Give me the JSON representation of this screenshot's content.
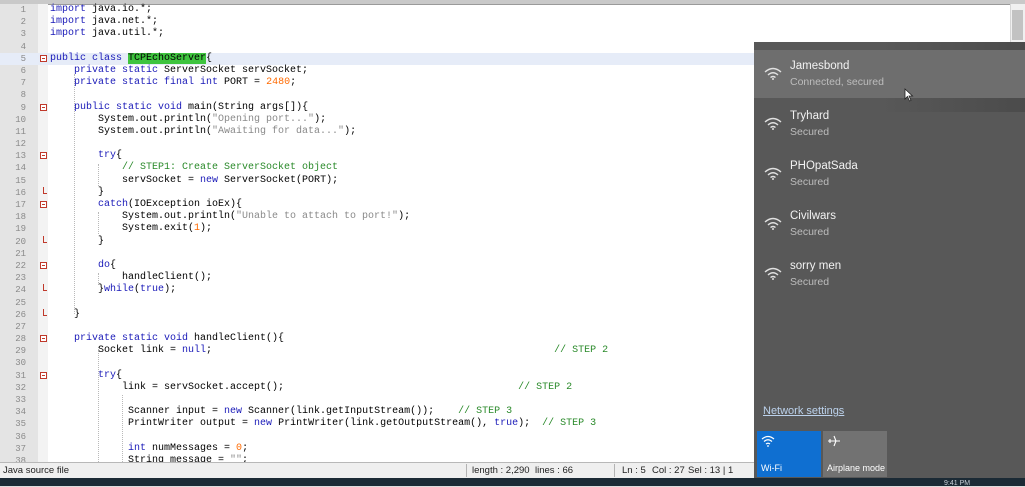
{
  "editor": {
    "lines": [
      {
        "n": "1",
        "fold": "",
        "parts": [
          [
            "kw",
            "import "
          ],
          [
            "",
            "java.io.*;"
          ]
        ]
      },
      {
        "n": "2",
        "fold": "",
        "parts": [
          [
            "kw",
            "import "
          ],
          [
            "",
            "java.net.*;"
          ]
        ]
      },
      {
        "n": "3",
        "fold": "",
        "parts": [
          [
            "kw",
            "import "
          ],
          [
            "",
            "java.util.*;"
          ]
        ]
      },
      {
        "n": "4",
        "fold": "",
        "parts": []
      },
      {
        "n": "5",
        "fold": "open",
        "current": true,
        "parts": [
          [
            "kw",
            "public class "
          ],
          [
            "hl",
            "TCPEchoServer"
          ],
          [
            "",
            "{"
          ]
        ]
      },
      {
        "n": "6",
        "fold": "",
        "parts": [
          [
            "",
            "    "
          ],
          [
            "kw",
            "private static "
          ],
          [
            "",
            "ServerSocket servSocket;"
          ]
        ]
      },
      {
        "n": "7",
        "fold": "",
        "parts": [
          [
            "",
            "    "
          ],
          [
            "kw",
            "private static final int "
          ],
          [
            "",
            "PORT = "
          ],
          [
            "num",
            "2480"
          ],
          [
            "",
            ";"
          ]
        ]
      },
      {
        "n": "8",
        "fold": "",
        "parts": []
      },
      {
        "n": "9",
        "fold": "open",
        "parts": [
          [
            "",
            "    "
          ],
          [
            "kw",
            "public static void "
          ],
          [
            "",
            "main(String args[]){"
          ]
        ]
      },
      {
        "n": "10",
        "fold": "",
        "parts": [
          [
            "",
            "        System.out.println("
          ],
          [
            "str",
            "\"Opening port...\""
          ],
          [
            "",
            ");"
          ]
        ]
      },
      {
        "n": "11",
        "fold": "",
        "parts": [
          [
            "",
            "        System.out.println("
          ],
          [
            "str",
            "\"Awaiting for data...\""
          ],
          [
            "",
            ");"
          ]
        ]
      },
      {
        "n": "12",
        "fold": "",
        "parts": []
      },
      {
        "n": "13",
        "fold": "open",
        "parts": [
          [
            "",
            "        "
          ],
          [
            "kw",
            "try"
          ],
          [
            "",
            "{"
          ]
        ]
      },
      {
        "n": "14",
        "fold": "",
        "parts": [
          [
            "",
            "            "
          ],
          [
            "cm",
            "// STEP1: Create ServerSocket object"
          ]
        ]
      },
      {
        "n": "15",
        "fold": "",
        "parts": [
          [
            "",
            "            servSocket = "
          ],
          [
            "kw",
            "new "
          ],
          [
            "",
            "ServerSocket(PORT);"
          ]
        ]
      },
      {
        "n": "16",
        "fold": "end",
        "parts": [
          [
            "",
            "        }"
          ]
        ]
      },
      {
        "n": "17",
        "fold": "open",
        "parts": [
          [
            "",
            "        "
          ],
          [
            "kw",
            "catch"
          ],
          [
            "",
            "(IOException ioEx){"
          ]
        ]
      },
      {
        "n": "18",
        "fold": "",
        "parts": [
          [
            "",
            "            System.out.println("
          ],
          [
            "str",
            "\"Unable to attach to port!\""
          ],
          [
            "",
            ");"
          ]
        ]
      },
      {
        "n": "19",
        "fold": "",
        "parts": [
          [
            "",
            "            System.exit("
          ],
          [
            "num",
            "1"
          ],
          [
            "",
            ");"
          ]
        ]
      },
      {
        "n": "20",
        "fold": "end",
        "parts": [
          [
            "",
            "        }"
          ]
        ]
      },
      {
        "n": "21",
        "fold": "",
        "parts": []
      },
      {
        "n": "22",
        "fold": "open",
        "parts": [
          [
            "",
            "        "
          ],
          [
            "kw",
            "do"
          ],
          [
            "",
            "{"
          ]
        ]
      },
      {
        "n": "23",
        "fold": "",
        "parts": [
          [
            "",
            "            handleClient();"
          ]
        ]
      },
      {
        "n": "24",
        "fold": "end",
        "parts": [
          [
            "",
            "        }"
          ],
          [
            "kw",
            "while"
          ],
          [
            "",
            "("
          ],
          [
            "kw",
            "true"
          ],
          [
            "",
            ");"
          ]
        ]
      },
      {
        "n": "25",
        "fold": "",
        "parts": []
      },
      {
        "n": "26",
        "fold": "end",
        "parts": [
          [
            "",
            "    }"
          ]
        ]
      },
      {
        "n": "27",
        "fold": "",
        "parts": []
      },
      {
        "n": "28",
        "fold": "open",
        "parts": [
          [
            "",
            "    "
          ],
          [
            "kw",
            "private static void "
          ],
          [
            "",
            "handleClient(){"
          ]
        ]
      },
      {
        "n": "29",
        "fold": "",
        "parts": [
          [
            "",
            "        Socket link = "
          ],
          [
            "kw",
            "null"
          ],
          [
            "",
            ";                                                         "
          ],
          [
            "cm",
            "// STEP 2"
          ]
        ]
      },
      {
        "n": "30",
        "fold": "",
        "parts": []
      },
      {
        "n": "31",
        "fold": "open",
        "parts": [
          [
            "",
            "        "
          ],
          [
            "kw",
            "try"
          ],
          [
            "",
            "{"
          ]
        ]
      },
      {
        "n": "32",
        "fold": "",
        "parts": [
          [
            "",
            "            link = servSocket.accept();                                       "
          ],
          [
            "cm",
            "// STEP 2"
          ]
        ]
      },
      {
        "n": "33",
        "fold": "",
        "parts": []
      },
      {
        "n": "34",
        "fold": "",
        "parts": [
          [
            "",
            "             Scanner input = "
          ],
          [
            "kw",
            "new "
          ],
          [
            "",
            "Scanner(link.getInputStream());    "
          ],
          [
            "cm",
            "// STEP 3"
          ]
        ]
      },
      {
        "n": "35",
        "fold": "",
        "parts": [
          [
            "",
            "             PrintWriter output = "
          ],
          [
            "kw",
            "new "
          ],
          [
            "",
            "PrintWriter(link.getOutputStream(), "
          ],
          [
            "kw",
            "true"
          ],
          [
            "",
            ");  "
          ],
          [
            "cm",
            "// STEP 3"
          ]
        ]
      },
      {
        "n": "36",
        "fold": "",
        "parts": []
      },
      {
        "n": "37",
        "fold": "",
        "parts": [
          [
            "",
            "             "
          ],
          [
            "kw",
            "int "
          ],
          [
            "",
            "numMessages = "
          ],
          [
            "num",
            "0"
          ],
          [
            "",
            ";"
          ]
        ]
      },
      {
        "n": "38",
        "fold": "",
        "parts": [
          [
            "",
            "             String message = "
          ],
          [
            "str",
            "\"\""
          ],
          [
            "",
            ";"
          ]
        ]
      }
    ]
  },
  "status": {
    "file_type": "Java source file",
    "length": "length : 2,290",
    "lines": "lines : 66",
    "ln": "Ln : 5",
    "col": "Col : 27",
    "sel": "Sel : 13 | 1"
  },
  "wifi": {
    "networks": [
      {
        "name": "Jamesbond",
        "status": "Connected, secured",
        "selected": true
      },
      {
        "name": "Tryhard",
        "status": "Secured",
        "selected": false
      },
      {
        "name": "PHOpatSada",
        "status": "Secured",
        "selected": false
      },
      {
        "name": "Civilwars",
        "status": "Secured",
        "selected": false
      },
      {
        "name": "sorry men",
        "status": "Secured",
        "selected": false
      }
    ],
    "settings_link": "Network settings",
    "quick_actions": [
      {
        "label": "Wi-Fi",
        "icon": "wifi-icon",
        "active": true
      },
      {
        "label": "Airplane mode",
        "icon": "airplane-icon",
        "active": false
      }
    ]
  },
  "taskbar": {
    "clock": "9:41 PM"
  },
  "colors": {
    "accent": "#0f6fd1",
    "flyout_bg": "#585858",
    "keyword": "#1a1ab8",
    "comment": "#2a8a2a",
    "number": "#ff6a00",
    "highlight": "#3ec43e"
  }
}
